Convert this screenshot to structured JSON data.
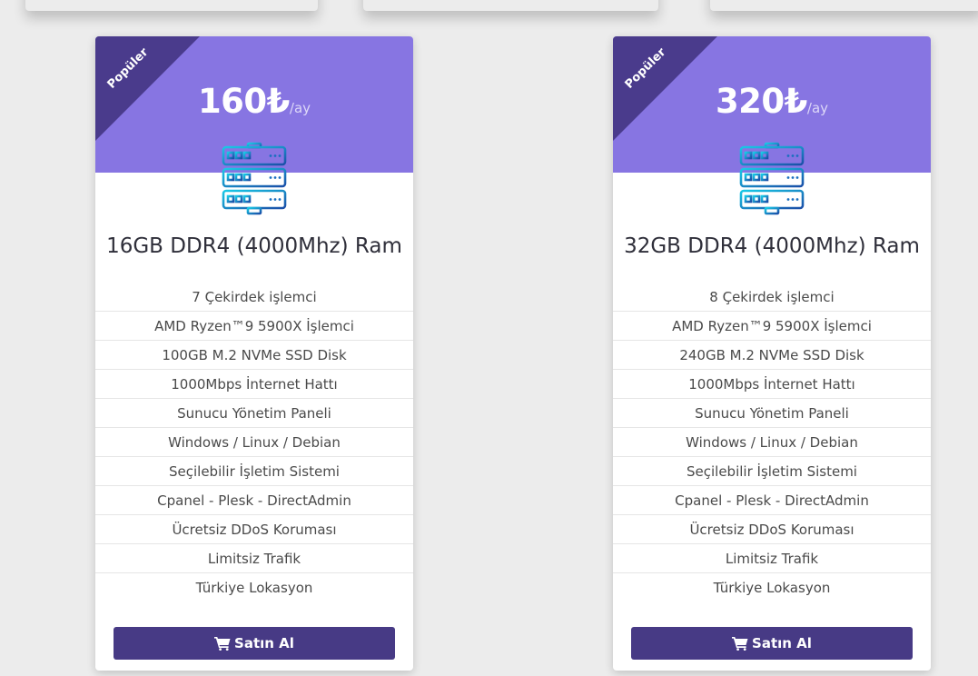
{
  "plans": [
    {
      "ribbon": "Popüler",
      "price": "160₺",
      "period": "/ay",
      "title": "16GB DDR4 (4000Mhz) Ram",
      "icon": "server-rack-icon",
      "features": [
        "7 Çekirdek işlemci",
        "AMD Ryzen™9 5900X İşlemci",
        "100GB M.2 NVMe SSD Disk",
        "1000Mbps İnternet Hattı",
        "Sunucu Yönetim Paneli",
        "Windows / Linux / Debian",
        "Seçilebilir İşletim Sistemi",
        "Cpanel - Plesk - DirectAdmin",
        "Ücretsiz DDoS Koruması",
        "Limitsiz Trafik",
        "Türkiye Lokasyon"
      ],
      "button_label": "Satın Al",
      "button_icon": "shopping-cart-icon"
    },
    {
      "ribbon": "Popüler",
      "price": "320₺",
      "period": "/ay",
      "title": "32GB DDR4 (4000Mhz) Ram",
      "icon": "server-rack-icon",
      "features": [
        "8 Çekirdek işlemci",
        "AMD Ryzen™9 5900X İşlemci",
        "240GB M.2 NVMe SSD Disk",
        "1000Mbps İnternet Hattı",
        "Sunucu Yönetim Paneli",
        "Windows / Linux / Debian",
        "Seçilebilir İşletim Sistemi",
        "Cpanel - Plesk - DirectAdmin",
        "Ücretsiz DDoS Koruması",
        "Limitsiz Trafik",
        "Türkiye Lokasyon"
      ],
      "button_label": "Satın Al",
      "button_icon": "shopping-cart-icon"
    }
  ],
  "colors": {
    "page_background": "#ececec",
    "header_background": "#8775e2",
    "ribbon_background": "#4a3b8c",
    "button_background": "#473a85",
    "icon_gradient_start": "#19c9e6",
    "icon_gradient_end": "#1a4fa8"
  }
}
